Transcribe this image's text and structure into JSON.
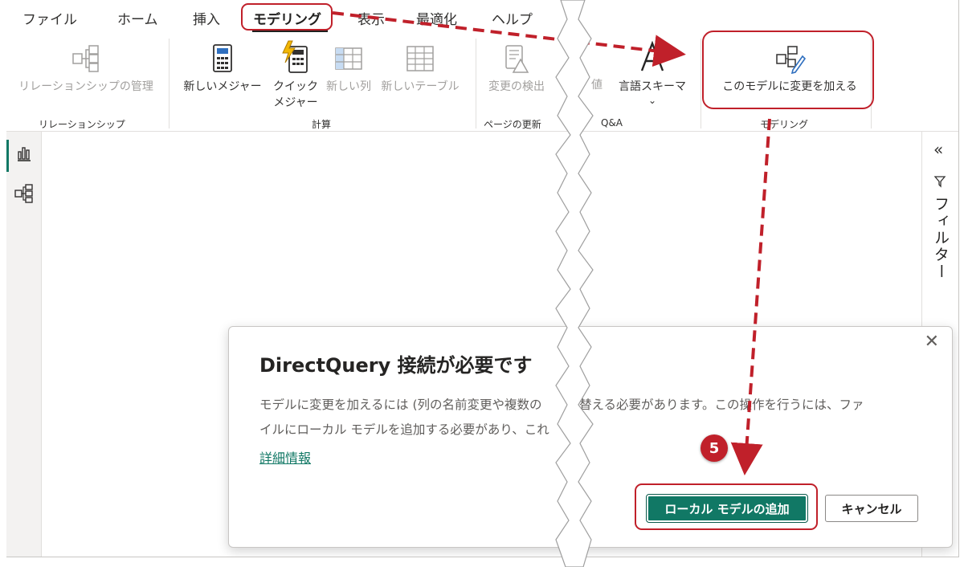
{
  "menu": {
    "items": [
      "ファイル",
      "ホーム",
      "挿入",
      "モデリング",
      "表示",
      "最適化",
      "ヘルプ"
    ],
    "active": "モデリング"
  },
  "ribbon": {
    "relationships": {
      "manage_label": "リレーションシップの管理",
      "group_label": "リレーションシップ"
    },
    "calculations": {
      "new_measure_label": "新しいメジャー",
      "quick_measure_line1": "クイック",
      "quick_measure_line2": "メジャー",
      "new_column_label": "新しい列",
      "new_table_label": "新しいテーブル",
      "group_label": "計算"
    },
    "page_refresh": {
      "detect_changes_label": "変更の検出",
      "group_label": "ページの更新"
    },
    "qa": {
      "partial_label": "値",
      "linguistic_schema_label": "言語スキーマ",
      "chevron": "⌄",
      "group_label": "Q&A"
    },
    "modeling": {
      "make_changes_label": "このモデルに変更を加える",
      "group_label": "モデリング"
    }
  },
  "filter_pane": {
    "collapse_glyph": "«",
    "label": "フィルター"
  },
  "dialog": {
    "title": "DirectQuery 接続が必要です",
    "body_line1": "モデルに変更を加えるには (列の名前変更や複数の　　り替える必要があります。この操作を行うには、ファ",
    "body_line2": "イルにローカル モデルを追加する必要があり、これ",
    "learn_more": "詳細情報",
    "close_glyph": "✕",
    "primary_button": "ローカル モデルの追加",
    "secondary_button": "キャンセル"
  },
  "annotation": {
    "step_number": "5",
    "accent_color": "#c0202a"
  },
  "colors": {
    "brand": "#117865",
    "border": "#e1dfdd"
  }
}
